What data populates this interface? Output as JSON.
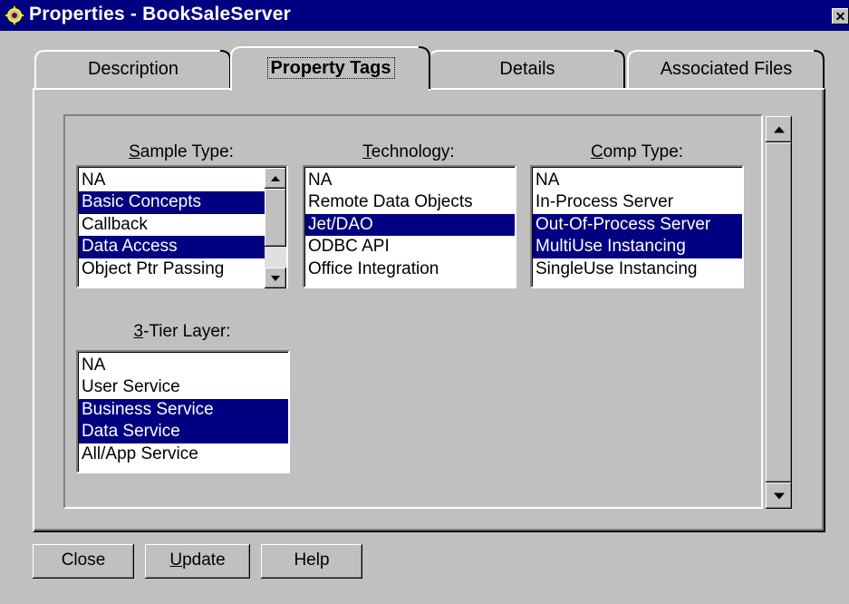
{
  "window": {
    "title": "Properties - BookSaleServer",
    "close_glyph": "✕"
  },
  "tabs": [
    {
      "label": "Description",
      "active": false
    },
    {
      "label": "Property Tags",
      "active": true
    },
    {
      "label": "Details",
      "active": false
    },
    {
      "label": "Associated Files",
      "active": false
    }
  ],
  "sample_type": {
    "label_mnemonic": "S",
    "label_rest": "ample Type:",
    "items": [
      {
        "text": "NA",
        "selected": false
      },
      {
        "text": "Basic Concepts",
        "selected": true
      },
      {
        "text": "Callback",
        "selected": false
      },
      {
        "text": "Data Access",
        "selected": true
      },
      {
        "text": "Object Ptr Passing",
        "selected": false
      }
    ]
  },
  "technology": {
    "label_mnemonic": "T",
    "label_rest": "echnology:",
    "items": [
      {
        "text": "NA",
        "selected": false
      },
      {
        "text": "Remote Data Objects",
        "selected": false
      },
      {
        "text": "Jet/DAO",
        "selected": true
      },
      {
        "text": "ODBC API",
        "selected": false
      },
      {
        "text": "Office Integration",
        "selected": false
      }
    ]
  },
  "comp_type": {
    "label_mnemonic": "C",
    "label_rest": "omp Type:",
    "items": [
      {
        "text": "NA",
        "selected": false
      },
      {
        "text": "In-Process Server",
        "selected": false
      },
      {
        "text": "Out-Of-Process Server",
        "selected": true
      },
      {
        "text": "MultiUse Instancing",
        "selected": true
      },
      {
        "text": "SingleUse Instancing",
        "selected": false
      }
    ]
  },
  "tier_layer": {
    "label_mnemonic": "3",
    "label_rest": "-Tier Layer:",
    "items": [
      {
        "text": "NA",
        "selected": false
      },
      {
        "text": "User Service",
        "selected": false
      },
      {
        "text": "Business Service",
        "selected": true
      },
      {
        "text": "Data Service",
        "selected": true
      },
      {
        "text": "All/App Service",
        "selected": false
      }
    ]
  },
  "buttons": {
    "close": "Close",
    "update_mnemonic": "U",
    "update_rest": "pdate",
    "help": "Help"
  },
  "colors": {
    "selection": "#000080",
    "face": "#c0c0c0",
    "titlebar": "#000080"
  },
  "icons": {
    "app": "app-icon",
    "scroll_up": "arrow-up-icon",
    "scroll_down": "arrow-down-icon"
  }
}
